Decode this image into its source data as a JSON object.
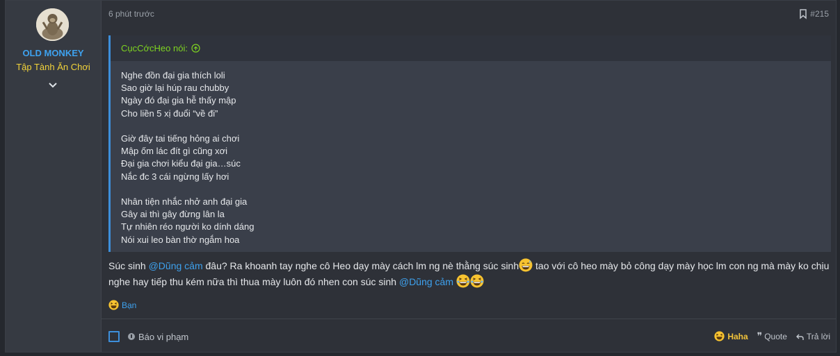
{
  "user": {
    "name": "OLD MONKEY",
    "title": "Tập Tành Ăn Chơi"
  },
  "post": {
    "time": "6 phút trước",
    "number": "#215"
  },
  "quote": {
    "author_label": "CụcCớcHeo nói:",
    "stanzas": [
      [
        "Nghe đồn đại gia thích loli",
        "Sao giờ lại húp rau chubby",
        "Ngày đó đại gia hễ thấy mập",
        "Cho liền 5 xị đuổi “về đi”"
      ],
      [
        "Giờ đây tai tiếng hỏng ai chơi",
        "Mập ốm lác đít gì cũng xơi",
        "Đại gia chơi kiểu đại gia…súc",
        "Nắc đc 3 cái ngừng lấy hơi"
      ],
      [
        "Nhân tiện nhắc nhở anh đại gia",
        "Gây ai thì gây đừng lân la",
        "Tự nhiên réo người ko dính dáng",
        "Nói xui leo bàn thờ ngắm hoa"
      ]
    ]
  },
  "message": {
    "p1": "Súc sinh ",
    "mention1": "@Dũng cảm",
    "p2": " đâu? Ra khoanh tay nghe cô Heo dạy mày cách lm ng nè thằng súc sinh",
    "p3": " tao với cô heo mày bỏ công dạy mày học lm con ng mà mày ko chịu nghe hay tiếp thu kém nữa thì thua mày luôn đó nhen con súc sinh ",
    "mention2": "@Dũng cảm"
  },
  "reactions": {
    "label": "Bạn"
  },
  "footer": {
    "report": "Báo vi phạm",
    "haha": "Haha",
    "quote": "Quote",
    "reply": "Trả lời"
  },
  "colors": {
    "accent": "#3ea2ef",
    "quote_author": "#7ed321",
    "user_title": "#f2d33a",
    "haha": "#f2c33a"
  },
  "icons": [
    "avatar-monkey",
    "chevron-down-icon",
    "bookmark-icon",
    "arrow-up-circle-icon",
    "grin-sweat-emoji",
    "laugh-emoji",
    "report-icon",
    "quote-icon",
    "reply-icon"
  ]
}
